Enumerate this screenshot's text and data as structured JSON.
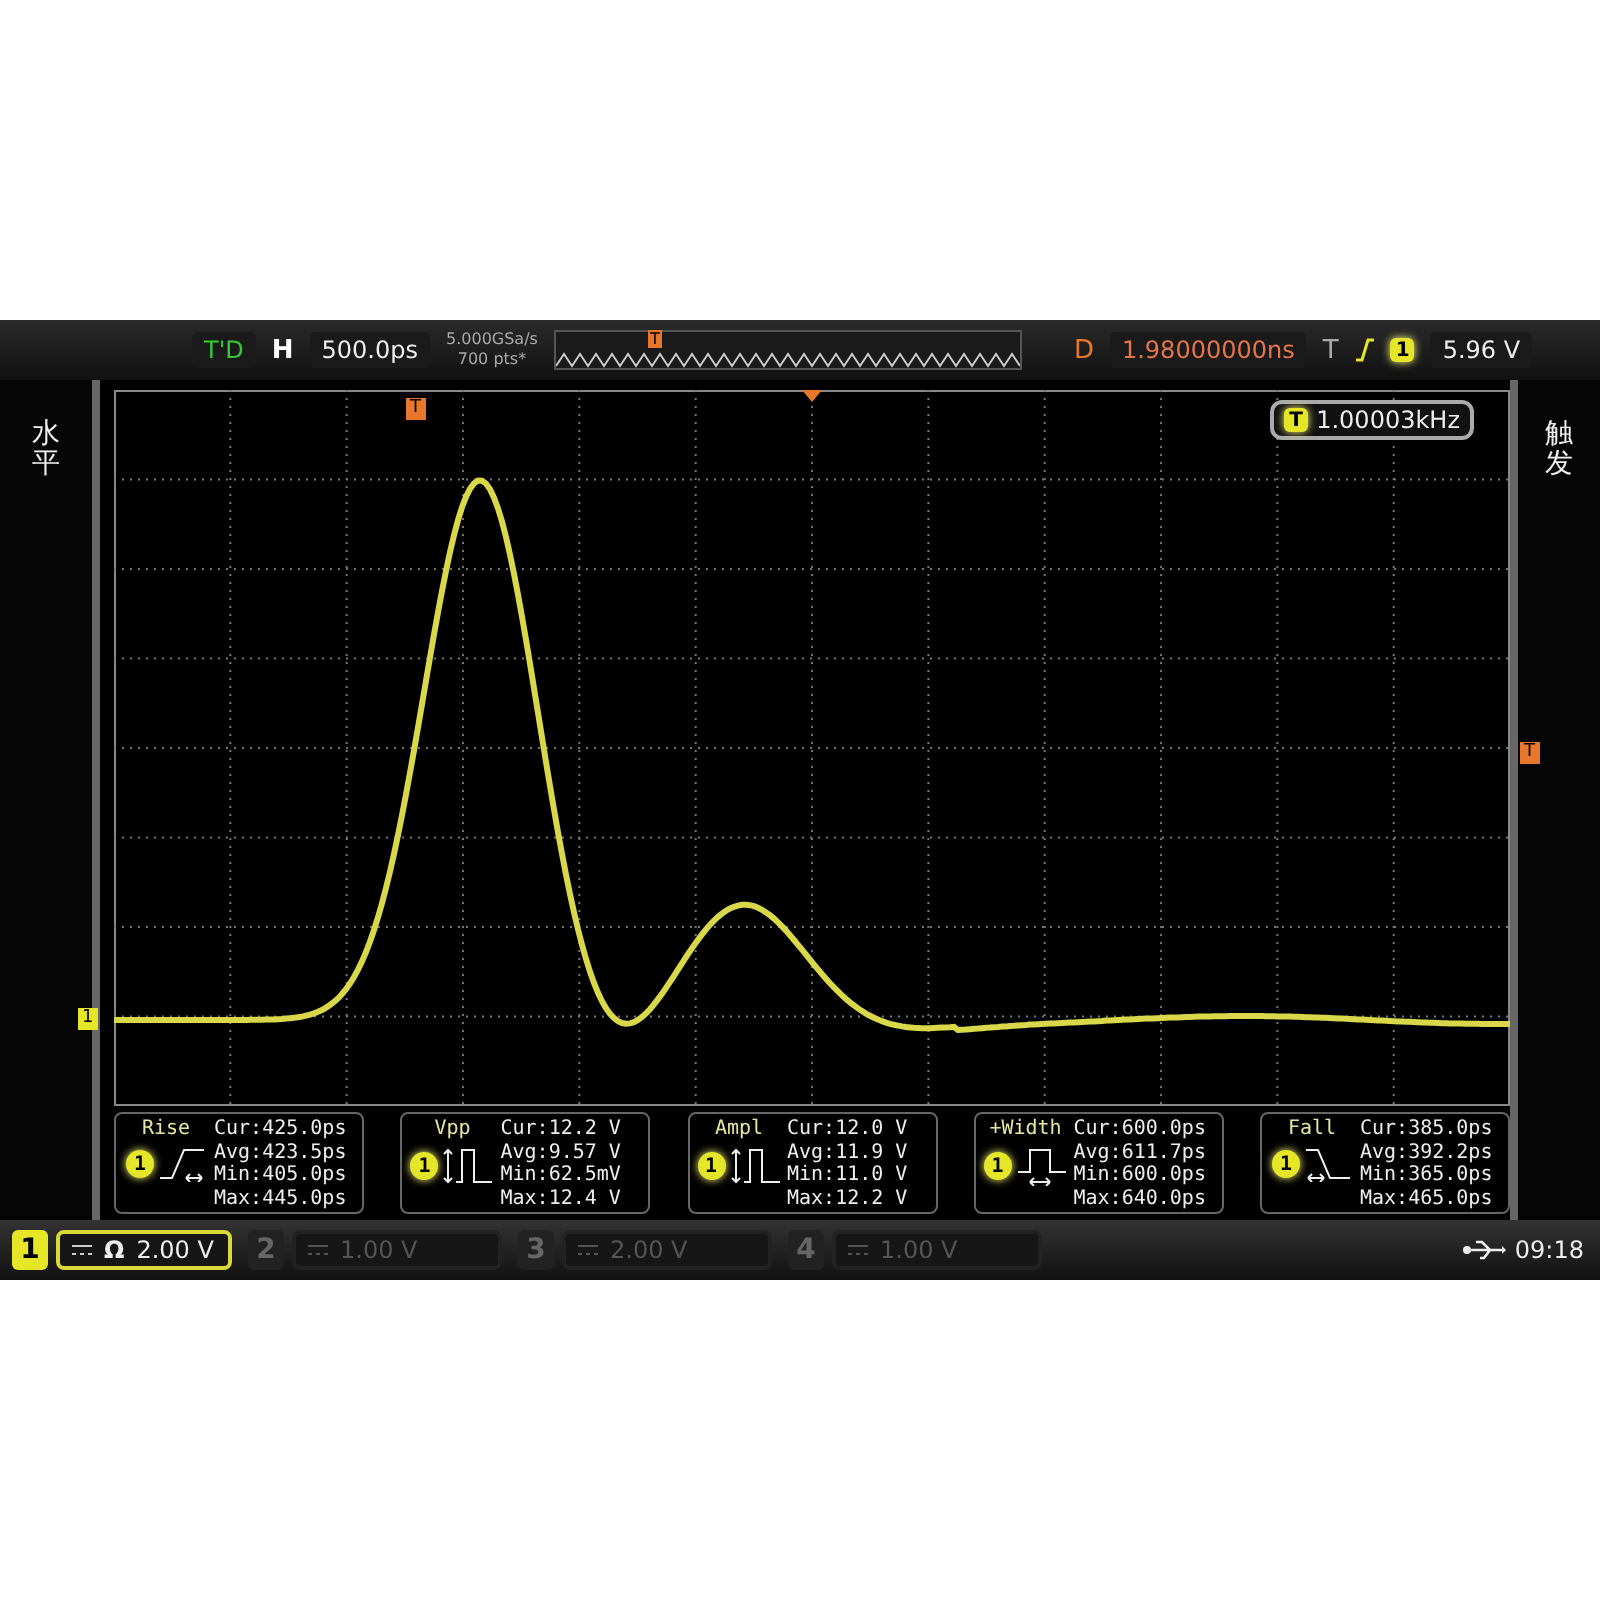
{
  "top_bar": {
    "run_state": "T'D",
    "h_label": "H",
    "timebase": "500.0ps",
    "sample_rate": "5.000GSa/s",
    "memory_depth": "700 pts*",
    "memory_trigger_marker": "T",
    "d_label": "D",
    "delay": "1.98000000ns",
    "t_label": "T",
    "trigger_source": "1",
    "trigger_level": "5.96 V"
  },
  "left_tab": {
    "label": "水平"
  },
  "right_tab": {
    "label": "触发"
  },
  "grid": {
    "trigger_position_marker": "T",
    "trigger_level_marker": "T",
    "channel_marker": "1",
    "frequency": {
      "source": "T",
      "value": "1.00003kHz"
    }
  },
  "measurements": [
    {
      "kind": "rise",
      "name": "Rise",
      "channel": "1",
      "lines": [
        "Cur:425.0ps",
        "Avg:423.5ps",
        "Min:405.0ps",
        "Max:445.0ps"
      ]
    },
    {
      "kind": "vpp",
      "name": "Vpp",
      "channel": "1",
      "lines": [
        "Cur:12.2 V",
        "Avg:9.57 V",
        "Min:62.5mV",
        "Max:12.4 V"
      ]
    },
    {
      "kind": "ampl",
      "name": "Ampl",
      "channel": "1",
      "lines": [
        "Cur:12.0 V",
        "Avg:11.9 V",
        "Min:11.0 V",
        "Max:12.2 V"
      ]
    },
    {
      "kind": "width",
      "name": "+Width",
      "channel": "1",
      "lines": [
        "Cur:600.0ps",
        "Avg:611.7ps",
        "Min:600.0ps",
        "Max:640.0ps"
      ]
    },
    {
      "kind": "fall",
      "name": "Fall",
      "channel": "1",
      "lines": [
        "Cur:385.0ps",
        "Avg:392.2ps",
        "Min:365.0ps",
        "Max:465.0ps"
      ]
    }
  ],
  "channels": [
    {
      "number": "1",
      "impedance": "Ω",
      "scale": "2.00 V",
      "selected": true
    },
    {
      "number": "2",
      "scale": "1.00 V",
      "selected": false
    },
    {
      "number": "3",
      "scale": "2.00 V",
      "selected": false
    },
    {
      "number": "4",
      "scale": "1.00 V",
      "selected": false
    }
  ],
  "status_bar": {
    "time": "09:18"
  }
}
